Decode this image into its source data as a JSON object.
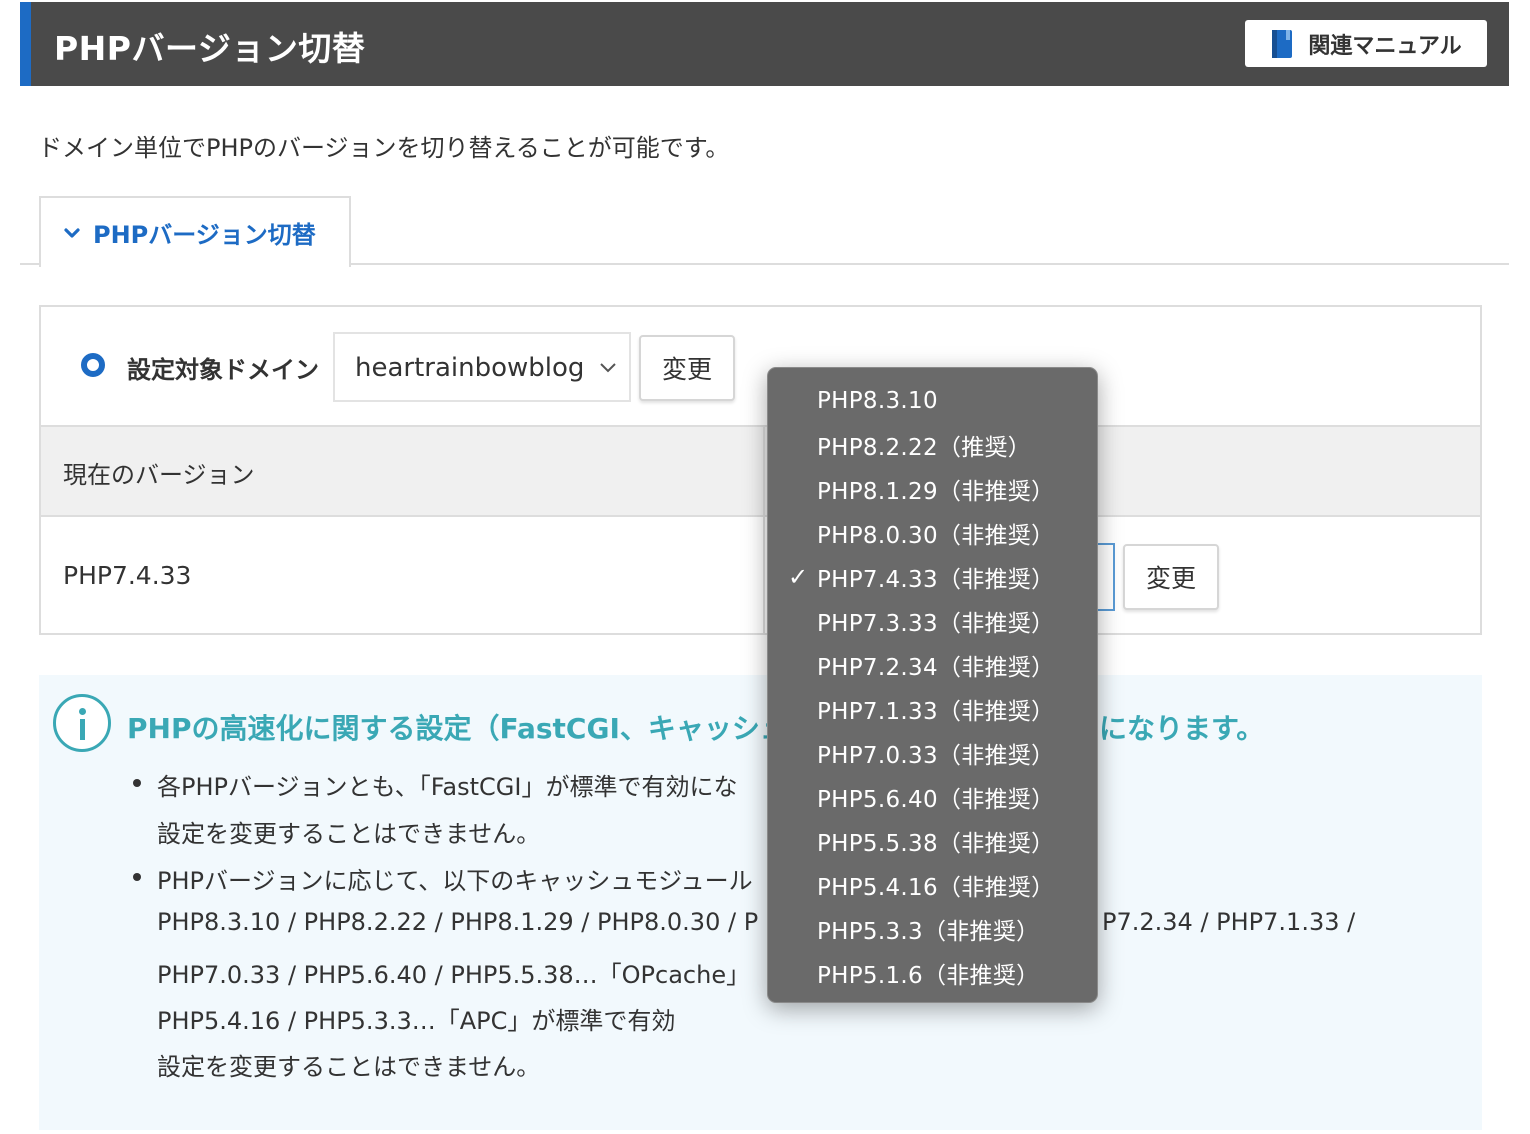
{
  "header": {
    "title": "PHPバージョン切替",
    "manual_button": "関連マニュアル",
    "colors": {
      "bar": "#4a4a4a",
      "accent": "#1d6bc4"
    }
  },
  "description": "ドメイン単位でPHPのバージョンを切り替えることが可能です。",
  "tab": {
    "label": "PHPバージョン切替",
    "icon": "chevron-down-icon"
  },
  "domain": {
    "label": "設定対象ドメイン",
    "selected": "heartrainbowblog.com",
    "change_button": "変更"
  },
  "version_table": {
    "current_header": "現在のバージョン",
    "current_value": "PHP7.4.33",
    "change_button": "変更"
  },
  "dropdown": {
    "options": [
      {
        "label": "PHP8.3.10",
        "checked": false
      },
      {
        "label": "PHP8.2.22（推奨）",
        "checked": false
      },
      {
        "label": "PHP8.1.29（非推奨）",
        "checked": false
      },
      {
        "label": "PHP8.0.30（非推奨）",
        "checked": false
      },
      {
        "label": "PHP7.4.33（非推奨）",
        "checked": true
      },
      {
        "label": "PHP7.3.33（非推奨）",
        "checked": false
      },
      {
        "label": "PHP7.2.34（非推奨）",
        "checked": false
      },
      {
        "label": "PHP7.1.33（非推奨）",
        "checked": false
      },
      {
        "label": "PHP7.0.33（非推奨）",
        "checked": false
      },
      {
        "label": "PHP5.6.40（非推奨）",
        "checked": false
      },
      {
        "label": "PHP5.5.38（非推奨）",
        "checked": false
      },
      {
        "label": "PHP5.4.16（非推奨）",
        "checked": false
      },
      {
        "label": "PHP5.3.3（非推奨）",
        "checked": false
      },
      {
        "label": "PHP5.1.6（非推奨）",
        "checked": false
      }
    ],
    "check_mark": "✓"
  },
  "info": {
    "title_start": "PHPの高速化に関する設定（FastCGI、キャッシュ",
    "title_end": "になります。",
    "lines": [
      "各PHPバージョンとも、「FastCGI」が標準で有効にな",
      "設定を変更することはできません。",
      "PHPバージョンに応じて、以下のキャッシュモジュール",
      "PHP8.3.10 / PHP8.2.22 / PHP8.1.29 / PHP8.0.30 / P",
      "P7.2.34 / PHP7.1.33 /",
      "PHP7.0.33 / PHP5.6.40 / PHP5.5.38…「OPcache」",
      "PHP5.4.16 / PHP5.3.3…「APC」が標準で有効",
      "設定を変更することはできません。"
    ],
    "color": "#3aa8b5"
  }
}
